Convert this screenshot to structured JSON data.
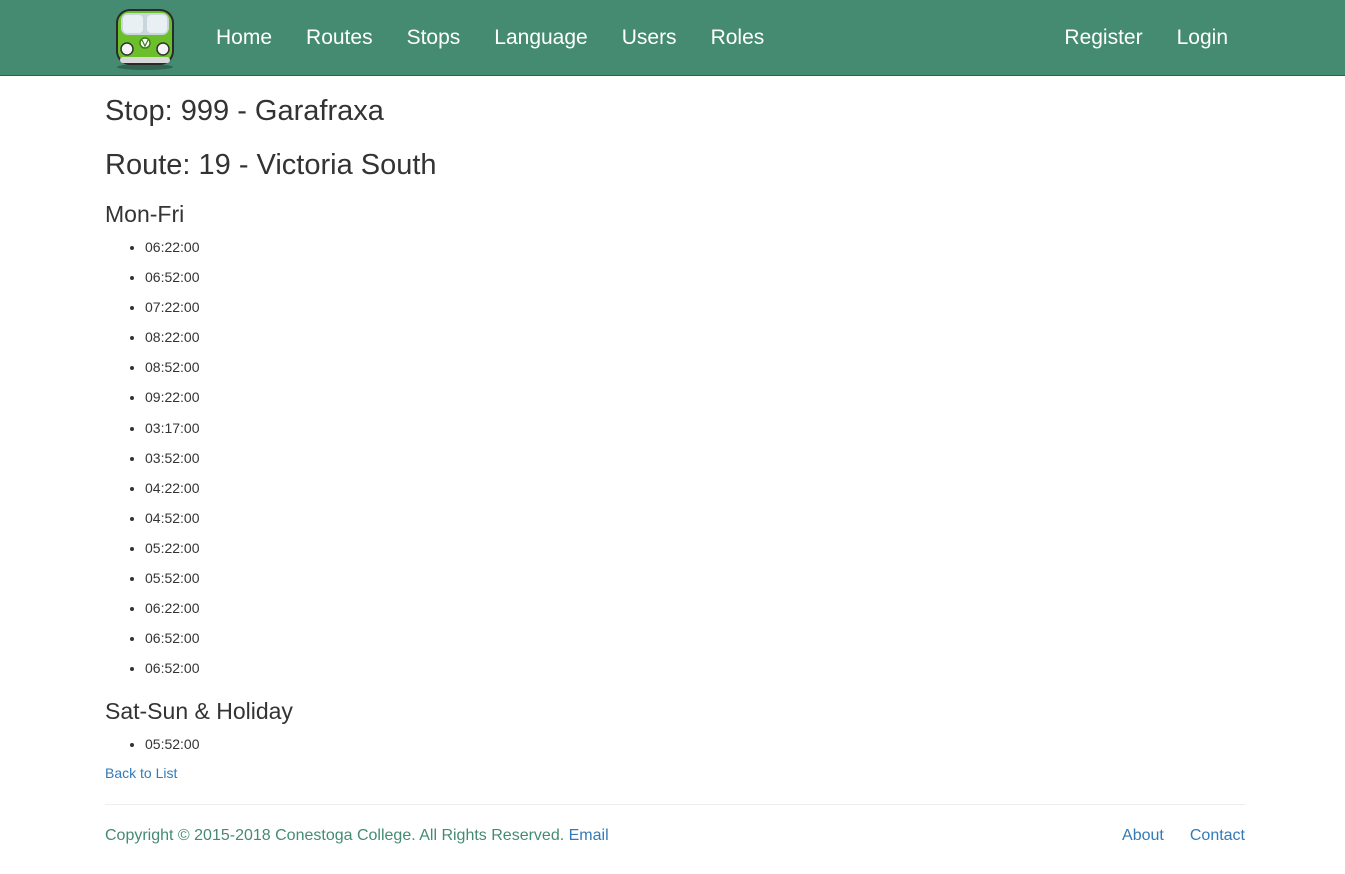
{
  "navbar": {
    "left_links": [
      "Home",
      "Routes",
      "Stops",
      "Language",
      "Users",
      "Roles"
    ],
    "right_links": [
      "Register",
      "Login"
    ],
    "background_color": "#458b72",
    "logo_icon": "green-van-icon"
  },
  "main": {
    "stop_heading": "Stop: 999 - Garafraxa",
    "route_heading": "Route: 19 - Victoria South",
    "weekday_heading": "Mon-Fri",
    "weekday_times": [
      "06:22:00",
      "06:52:00",
      "07:22:00",
      "08:22:00",
      "08:52:00",
      "09:22:00",
      "03:17:00",
      "03:52:00",
      "04:22:00",
      "04:52:00",
      "05:22:00",
      "05:52:00",
      "06:22:00",
      "06:52:00",
      "06:52:00"
    ],
    "weekend_heading": "Sat-Sun & Holiday",
    "weekend_times": [
      "05:52:00"
    ],
    "back_link": "Back to List"
  },
  "footer": {
    "copyright": "Copyright © 2015-2018 Conestoga College. All Rights Reserved.",
    "email_link": "Email",
    "about_link": "About",
    "contact_link": "Contact"
  }
}
